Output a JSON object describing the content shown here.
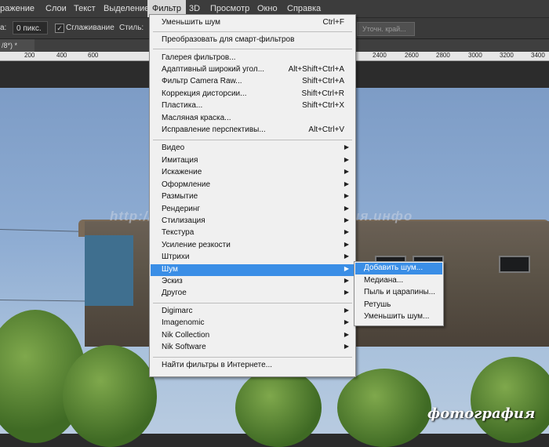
{
  "menubar": [
    "ражение",
    "Слои",
    "Текст",
    "Выделение",
    "Фильтр",
    "3D",
    "Просмотр",
    "Окно",
    "Справка"
  ],
  "options": {
    "feather_value": "0 пикс.",
    "antialias_label": "Сглаживание",
    "antialias_check": "✓",
    "style_label": "Стиль:",
    "refine_button": "Уточн. край..."
  },
  "tab": {
    "label": "/8*) *"
  },
  "ruler": [
    "200",
    "400",
    "600",
    "2400",
    "2600",
    "2800",
    "3000",
    "3200",
    "3400"
  ],
  "menu": {
    "top": [
      {
        "label": "Уменьшить шум",
        "shortcut": "Ctrl+F"
      },
      {
        "label": "Преобразовать для смарт-фильтров",
        "shortcut": ""
      }
    ],
    "group1": [
      {
        "label": "Галерея фильтров...",
        "shortcut": ""
      },
      {
        "label": "Адаптивный широкий угол...",
        "shortcut": "Alt+Shift+Ctrl+A"
      },
      {
        "label": "Фильтр Camera Raw...",
        "shortcut": "Shift+Ctrl+A"
      },
      {
        "label": "Коррекция дисторсии...",
        "shortcut": "Shift+Ctrl+R"
      },
      {
        "label": "Пластика...",
        "shortcut": "Shift+Ctrl+X"
      },
      {
        "label": "Масляная краска...",
        "shortcut": ""
      },
      {
        "label": "Исправление перспективы...",
        "shortcut": "Alt+Ctrl+V"
      }
    ],
    "group2": [
      "Видео",
      "Имитация",
      "Искажение",
      "Оформление",
      "Размытие",
      "Рендеринг",
      "Стилизация",
      "Текстура",
      "Усиление резкости",
      "Штрихи",
      "Шум",
      "Эскиз",
      "Другое"
    ],
    "group3": [
      "Digimarc",
      "Imagenomic",
      "Nik Collection",
      "Nik Software"
    ],
    "bottom": "Найти фильтры в Интернете...",
    "arrow": "▶"
  },
  "submenu": [
    "Добавить шум...",
    "Медиана...",
    "Пыль и царапины...",
    "Ретушь",
    "Уменьшить шум..."
  ],
  "watermark": "http://fotografiya.info/  фотография.инфо",
  "signature": "фотография",
  "colors": {
    "highlight": "#3a8ee6",
    "menu_bg": "#f0f0f0",
    "menubar": "#3c3c3c"
  }
}
